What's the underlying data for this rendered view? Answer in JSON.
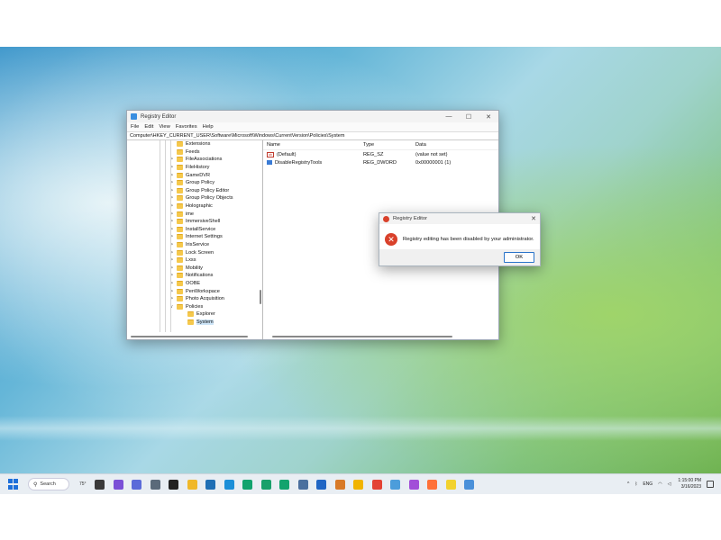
{
  "regedit": {
    "title": "Registry Editor",
    "controls": {
      "minimize": "—",
      "maximize": "☐",
      "close": "✕"
    },
    "menu": [
      "File",
      "Edit",
      "View",
      "Favorites",
      "Help"
    ],
    "address": "Computer\\HKEY_CURRENT_USER\\Software\\Microsoft\\Windows\\CurrentVersion\\Policies\\System",
    "tree": [
      {
        "label": "Extensions",
        "expander": ""
      },
      {
        "label": "Feeds",
        "expander": ""
      },
      {
        "label": "FileAssociations",
        "expander": ">"
      },
      {
        "label": "FileHistory",
        "expander": ">"
      },
      {
        "label": "GameDVR",
        "expander": ">"
      },
      {
        "label": "Group Policy",
        "expander": ">"
      },
      {
        "label": "Group Policy Editor",
        "expander": ">"
      },
      {
        "label": "Group Policy Objects",
        "expander": ">"
      },
      {
        "label": "Holographic",
        "expander": ">"
      },
      {
        "label": "ime",
        "expander": ">"
      },
      {
        "label": "ImmersiveShell",
        "expander": ">"
      },
      {
        "label": "InstallService",
        "expander": ">"
      },
      {
        "label": "Internet Settings",
        "expander": ">"
      },
      {
        "label": "IrisService",
        "expander": ">"
      },
      {
        "label": "Lock Screen",
        "expander": ">"
      },
      {
        "label": "Lxss",
        "expander": ">"
      },
      {
        "label": "Mobility",
        "expander": ">"
      },
      {
        "label": "Notifications",
        "expander": ">"
      },
      {
        "label": "OOBE",
        "expander": ">"
      },
      {
        "label": "PenWorkspace",
        "expander": ">"
      },
      {
        "label": "Photo Acquisition",
        "expander": ">"
      },
      {
        "label": "Policies",
        "expander": "v"
      },
      {
        "label": "Explorer",
        "expander": ""
      },
      {
        "label": "System",
        "expander": ""
      }
    ],
    "columns": {
      "name": "Name",
      "type": "Type",
      "data": "Data"
    },
    "values": [
      {
        "icon": "ab",
        "name": "(Default)",
        "type": "REG_SZ",
        "data": "(value not set)"
      },
      {
        "icon": "binary",
        "name": "DisableRegistryTools",
        "type": "REG_DWORD",
        "data": "0x00000001 (1)"
      }
    ]
  },
  "dialog": {
    "title": "Registry Editor",
    "close": "✕",
    "error_symbol": "✕",
    "message": "Registry editing has been disabled by your administrator.",
    "ok_label": "OK"
  },
  "taskbar": {
    "search_label": "Search",
    "weather_temp": "75°",
    "language": "ENG",
    "time": "1:15:00 PM",
    "date": "3/16/2023",
    "app_icon_colors": [
      "#3a3a3a",
      "#7a4fd6",
      "#5b6bd9",
      "#5a6a7a",
      "#222222",
      "#f0b829",
      "#1f6fb5",
      "#1c8fd8",
      "#12a36d",
      "#18a06a",
      "#12a36d",
      "#4a6f9e",
      "#2166c4",
      "#d87a28",
      "#f1b400",
      "#e34234",
      "#4c9ddb",
      "#a24ed8",
      "#ff7139",
      "#f2d22e",
      "#4a90d9"
    ]
  }
}
